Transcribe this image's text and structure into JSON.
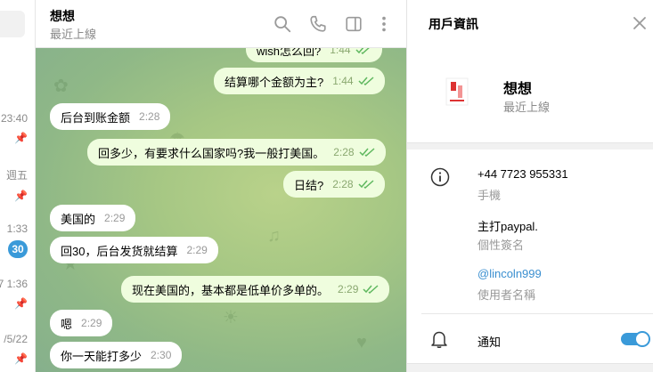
{
  "chat_list": {
    "items": [
      {
        "time": "23:40",
        "pinned": true
      },
      {
        "time": "週五",
        "pinned": true
      },
      {
        "time": "1:33",
        "unread": "30"
      },
      {
        "time": "7 1:36",
        "pinned": true
      },
      {
        "time": "/5/22",
        "pinned": true
      }
    ]
  },
  "chat": {
    "title": "想想",
    "status": "最近上線",
    "messages": [
      {
        "dir": "out",
        "text": "wish怎么回?",
        "time": "1:44"
      },
      {
        "dir": "out",
        "text": "结算哪个金额为主?",
        "time": "1:44"
      },
      {
        "dir": "in",
        "text": "后台到账金额",
        "time": "2:28"
      },
      {
        "dir": "out",
        "text": "回多少，有要求什么国家吗?我一般打美国。",
        "time": "2:28"
      },
      {
        "dir": "out",
        "text": "日结?",
        "time": "2:28"
      },
      {
        "dir": "in",
        "text": "美国的",
        "time": "2:29"
      },
      {
        "dir": "in",
        "text": "回30，后台发货就结算",
        "time": "2:29"
      },
      {
        "dir": "out",
        "text": "现在美国的，基本都是低单价多单的。",
        "time": "2:29"
      },
      {
        "dir": "in",
        "text": "嗯",
        "time": "2:29"
      },
      {
        "dir": "in",
        "text": "你一天能打多少",
        "time": "2:30"
      }
    ]
  },
  "panel": {
    "title": "用戶資訊",
    "name": "想想",
    "status": "最近上線",
    "phone": "+44 7723 955331",
    "phone_label": "手機",
    "bio": "主打paypal.",
    "bio_label": "個性簽名",
    "username": "@lincoln999",
    "username_label": "使用者名稱",
    "notifications_label": "通知",
    "notifications_on": true
  },
  "colors": {
    "accent": "#3a9ad9",
    "outgoing_bubble": "#effdde",
    "check_green": "#5fb85f",
    "link": "#3a8fd0"
  },
  "icons": [
    "search-icon",
    "phone-icon",
    "sidebar-toggle-icon",
    "more-vertical-icon",
    "close-icon",
    "info-icon",
    "bell-icon",
    "pin-icon"
  ]
}
